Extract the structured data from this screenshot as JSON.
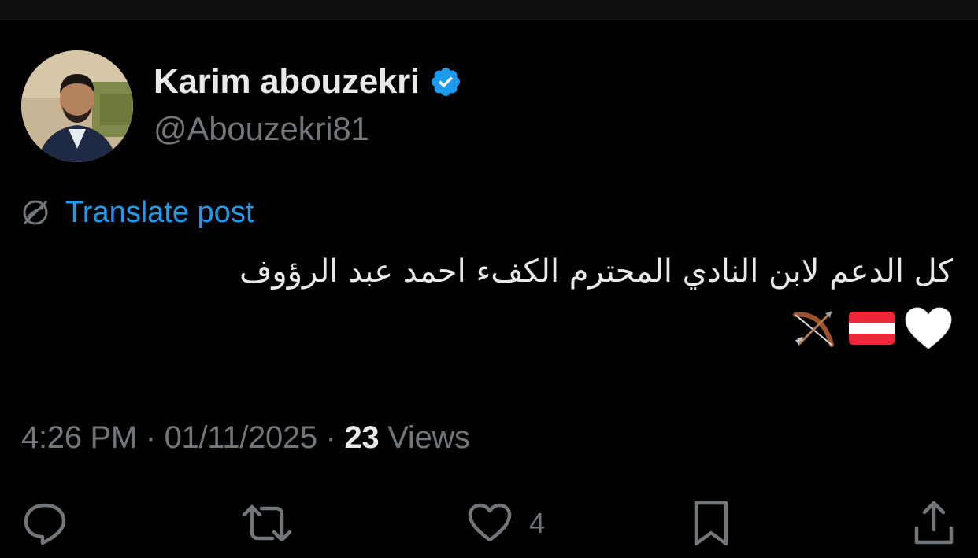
{
  "author": {
    "display_name": "Karim abouzekri",
    "handle": "@Abouzekri81",
    "avatar_icon": "avatar-photo",
    "verified_icon": "verified-badge-icon",
    "verified_color": "#1d9bf0"
  },
  "translate": {
    "icon": "translate-globe-icon",
    "label": "Translate post",
    "color": "#1d9bf0"
  },
  "post": {
    "text": "كل الدعم لابن النادي المحترم الكفء احمد عبد الرؤوف",
    "emojis": [
      "white-heart-emoji",
      "austria-flag-emoji",
      "bow-and-arrow-emoji"
    ]
  },
  "meta": {
    "time": "4:26 PM",
    "separator": "·",
    "date": "01/11/2025",
    "views_count": "23",
    "views_label": "Views"
  },
  "actions": {
    "reply_icon": "reply-icon",
    "repost_icon": "repost-icon",
    "like_icon": "heart-icon",
    "like_count": "4",
    "bookmark_icon": "bookmark-icon",
    "share_icon": "share-icon"
  }
}
